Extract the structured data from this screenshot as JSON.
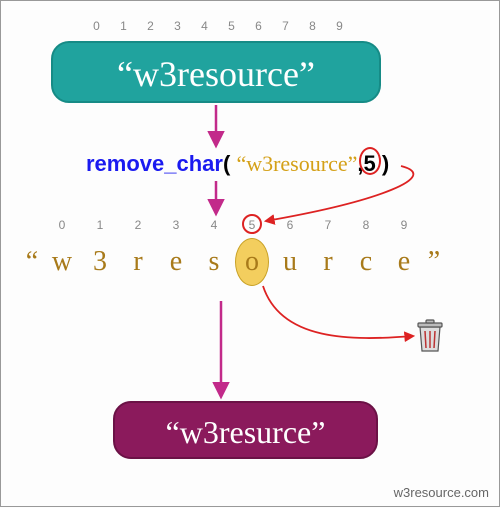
{
  "top_indices": [
    "0",
    "1",
    "2",
    "3",
    "4",
    "5",
    "6",
    "7",
    "8",
    "9"
  ],
  "box1_text": "“w3resource”",
  "fn": {
    "name": "remove_char",
    "open": "( ",
    "arg_str": "“w3resource”",
    "comma": ",",
    "arg_num": "5",
    "close": " )"
  },
  "spread": {
    "open_quote": "“",
    "chars": [
      "w",
      "3",
      "r",
      "e",
      "s",
      "o",
      "u",
      "r",
      "c",
      "e"
    ],
    "indices": [
      "0",
      "1",
      "2",
      "3",
      "4",
      "5",
      "6",
      "7",
      "8",
      "9"
    ],
    "close_quote": "”",
    "highlight_index": 5
  },
  "box2_text": "“w3resurce”",
  "footer": "w3resource.com"
}
